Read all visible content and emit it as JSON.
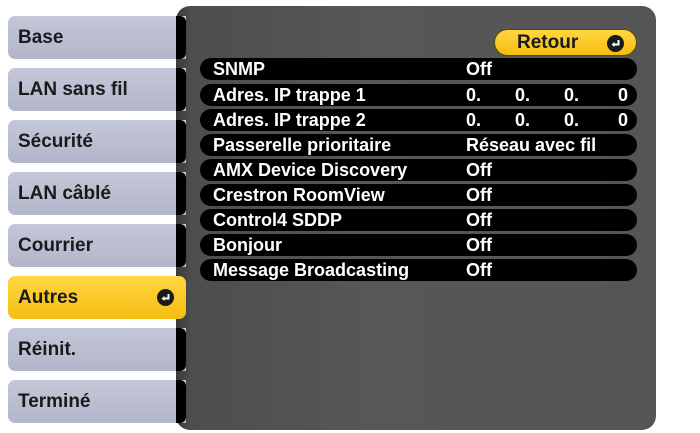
{
  "sidebar": {
    "items": [
      {
        "label": "Base"
      },
      {
        "label": "LAN sans fil"
      },
      {
        "label": "Sécurité"
      },
      {
        "label": "LAN câblé"
      },
      {
        "label": "Courrier"
      },
      {
        "label": "Autres",
        "active": true
      },
      {
        "label": "Réinit."
      },
      {
        "label": "Terminé"
      }
    ]
  },
  "main": {
    "return_label": "Retour",
    "rows": [
      {
        "label": "SNMP",
        "value": "Off"
      },
      {
        "label": "Adres. IP trappe 1",
        "ip": [
          "0.",
          "0.",
          "0.",
          "0"
        ]
      },
      {
        "label": "Adres. IP trappe 2",
        "ip": [
          "0.",
          "0.",
          "0.",
          "0"
        ]
      },
      {
        "label": "Passerelle prioritaire",
        "value": "Réseau avec fil"
      },
      {
        "label": "AMX Device Discovery",
        "value": "Off"
      },
      {
        "label": "Crestron RoomView",
        "value": "Off"
      },
      {
        "label": "Control4 SDDP",
        "value": "Off"
      },
      {
        "label": "Bonjour",
        "value": "Off"
      },
      {
        "label": "Message Broadcasting",
        "value": "Off"
      }
    ]
  },
  "colors": {
    "tab_bg": "#b9bccf",
    "tab_active_bg": "#f9c520",
    "panel_bg": "#555555",
    "row_bg": "#000000"
  }
}
